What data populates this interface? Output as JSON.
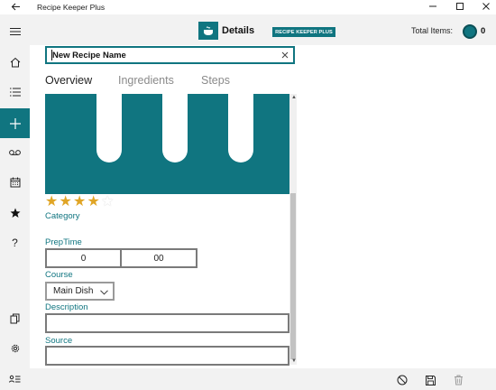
{
  "window": {
    "title": "Recipe Keeper Plus",
    "icons": [
      "back-arrow-icon",
      "minimize-icon",
      "maximize-icon",
      "close-icon"
    ]
  },
  "nav": {
    "items": [
      {
        "icon": "hamburger-menu-icon"
      },
      {
        "icon": "home-icon"
      },
      {
        "icon": "list-icon"
      },
      {
        "icon": "add-icon",
        "active": true
      },
      {
        "icon": "voicemail-icon"
      },
      {
        "icon": "calendar-icon"
      },
      {
        "icon": "star-icon"
      },
      {
        "icon": "help-icon"
      },
      {
        "icon": "copy-icon"
      },
      {
        "icon": "settings-icon"
      },
      {
        "icon": "contact-list-icon"
      }
    ]
  },
  "header": {
    "logo_icon": "cooking-pot-icon",
    "title": "Details",
    "brand_badge": "RECIPE KEEPER PLUS",
    "total_label": "Total Items:",
    "total_count": "0"
  },
  "recipe": {
    "name_value": "New Recipe Name",
    "tabs": [
      {
        "label": "Overview",
        "selected": true
      },
      {
        "label": "Ingredients",
        "selected": false
      },
      {
        "label": "Steps",
        "selected": false
      }
    ],
    "rating": 4,
    "rating_max": 5,
    "category_label": "Category",
    "preptime_label": "PrepTime",
    "preptime_hours": "0",
    "preptime_minutes": "00",
    "course_label": "Course",
    "course_value": "Main Dish",
    "description_label": "Description",
    "source_label": "Source"
  },
  "commands": {
    "icons": [
      "cancel-icon",
      "save-icon",
      "delete-icon"
    ]
  },
  "colors": {
    "accent": "#107580",
    "star_filled": "#e0a526",
    "star_empty": "#ffffff",
    "tab_inactive": "#8a8a8a",
    "rail_bg": "#f2f2f2"
  }
}
